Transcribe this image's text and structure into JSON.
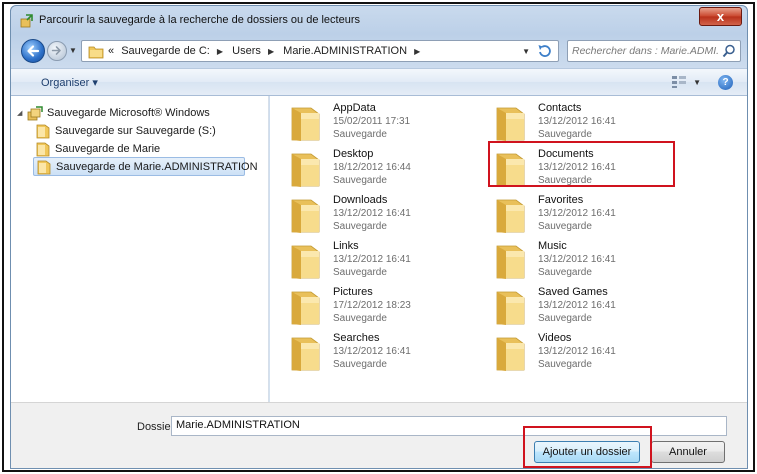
{
  "window": {
    "title": "Parcourir la sauvegarde à la recherche de dossiers ou de lecteurs",
    "close_glyph": "x"
  },
  "address": {
    "overflow": "«",
    "crumbs": [
      "Sauvegarde de C:",
      "Users",
      "Marie.ADMINISTRATION"
    ]
  },
  "search": {
    "placeholder": "Rechercher dans : Marie.ADMI..."
  },
  "toolbar": {
    "organise_label": "Organiser ▾",
    "help_label": "?"
  },
  "tree": {
    "root": "Sauvegarde Microsoft® Windows",
    "items": [
      "Sauvegarde sur Sauvegarde (S:)",
      "Sauvegarde de Marie",
      "Sauvegarde de Marie.ADMINISTRATION"
    ]
  },
  "folders": [
    {
      "name": "AppData",
      "date": "15/02/2011 17:31",
      "type": "Sauvegarde"
    },
    {
      "name": "Contacts",
      "date": "13/12/2012 16:41",
      "type": "Sauvegarde"
    },
    {
      "name": "Desktop",
      "date": "18/12/2012 16:44",
      "type": "Sauvegarde"
    },
    {
      "name": "Documents",
      "date": "13/12/2012 16:41",
      "type": "Sauvegarde"
    },
    {
      "name": "Downloads",
      "date": "13/12/2012 16:41",
      "type": "Sauvegarde"
    },
    {
      "name": "Favorites",
      "date": "13/12/2012 16:41",
      "type": "Sauvegarde"
    },
    {
      "name": "Links",
      "date": "13/12/2012 16:41",
      "type": "Sauvegarde"
    },
    {
      "name": "Music",
      "date": "13/12/2012 16:41",
      "type": "Sauvegarde"
    },
    {
      "name": "Pictures",
      "date": "17/12/2012 18:23",
      "type": "Sauvegarde"
    },
    {
      "name": "Saved Games",
      "date": "13/12/2012 16:41",
      "type": "Sauvegarde"
    },
    {
      "name": "Searches",
      "date": "13/12/2012 16:41",
      "type": "Sauvegarde"
    },
    {
      "name": "Videos",
      "date": "13/12/2012 16:41",
      "type": "Sauvegarde"
    }
  ],
  "footer": {
    "dossier_label": "Dossier :",
    "dossier_value": "Marie.ADMINISTRATION",
    "add_button": "Ajouter un dossier",
    "cancel_button": "Annuler"
  },
  "colors": {
    "highlight": "#d0131e",
    "folder": "#f3cf6b"
  }
}
